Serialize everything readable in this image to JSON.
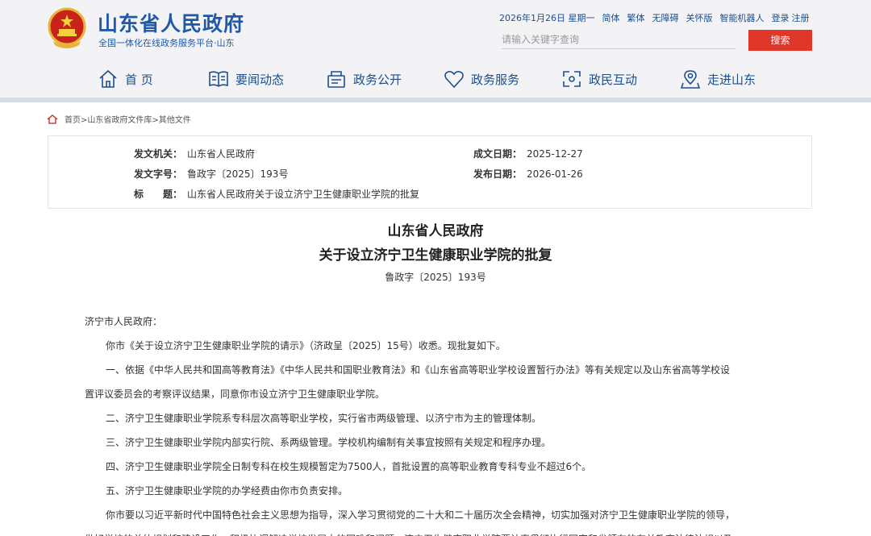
{
  "site": {
    "title": "山东省人民政府",
    "subtitle": "全国一体化在线政务服务平台·山东"
  },
  "top_links": {
    "date": "2026年1月26日 星期一",
    "simplified": "简体",
    "traditional": "繁体",
    "accessible": "无障碍",
    "elderly": "关怀版",
    "robot": "智能机器人",
    "login": "登录",
    "register": "注册"
  },
  "search": {
    "placeholder": "请输入关键字查询",
    "button": "搜索"
  },
  "nav": [
    {
      "label": "首 页",
      "icon": "home-icon"
    },
    {
      "label": "要闻动态",
      "icon": "book-icon"
    },
    {
      "label": "政务公开",
      "icon": "document-icon"
    },
    {
      "label": "政务服务",
      "icon": "heart-icon"
    },
    {
      "label": "政民互动",
      "icon": "interact-icon"
    },
    {
      "label": "走进山东",
      "icon": "location-icon"
    }
  ],
  "breadcrumb": "首页>山东省政府文件库>其他文件",
  "info": {
    "issuer_label": "发文机关：",
    "issuer": "山东省人民政府",
    "number_label": "发文字号：",
    "number": "鲁政字〔2025〕193号",
    "subject_label": "标　　题：",
    "subject": "山东省人民政府关于设立济宁卫生健康职业学院的批复",
    "written_label": "成文日期：",
    "written": "2025-12-27",
    "published_label": "发布日期：",
    "published": "2026-01-26"
  },
  "doc": {
    "title1": "山东省人民政府",
    "title2": "关于设立济宁卫生健康职业学院的批复",
    "number": "鲁政字〔2025〕193号",
    "paragraphs": [
      "济宁市人民政府：",
      "你市《关于设立济宁卫生健康职业学院的请示》（济政呈〔2025〕15号）收悉。现批复如下。",
      "一、依据《中华人民共和国高等教育法》《中华人民共和国职业教育法》和《山东省高等职业学校设置暂行办法》等有关规定以及山东省高等学校设",
      "置评议委员会的考察评议结果，同意你市设立济宁卫生健康职业学院。",
      "二、济宁卫生健康职业学院系专科层次高等职业学校，实行省市两级管理、以济宁市为主的管理体制。",
      "三、济宁卫生健康职业学院内部实行院、系两级管理。学校机构编制有关事宜按照有关规定和程序办理。",
      "四、济宁卫生健康职业学院全日制专科在校生规模暂定为7500人，首批设置的高等职业教育专科专业不超过6个。",
      "五、济宁卫生健康职业学院的办学经费由你市负责安排。",
      "你市要以习近平新时代中国特色社会主义思想为指导，深入学习贯彻党的二十大和二十届历次全会精神，切实加强对济宁卫生健康职业学院的领导，",
      "做好学校的总体规划和建设工作，积极协调解决学校发展中的困难和问题。济宁卫生健康职业学院要认真贯彻执行国家和省颁布的有关教育法律法规以及"
    ]
  },
  "colors": {
    "brand_blue": "#1f59a8",
    "search_red": "#e0372b",
    "header_bg": "#f3f3f5"
  }
}
